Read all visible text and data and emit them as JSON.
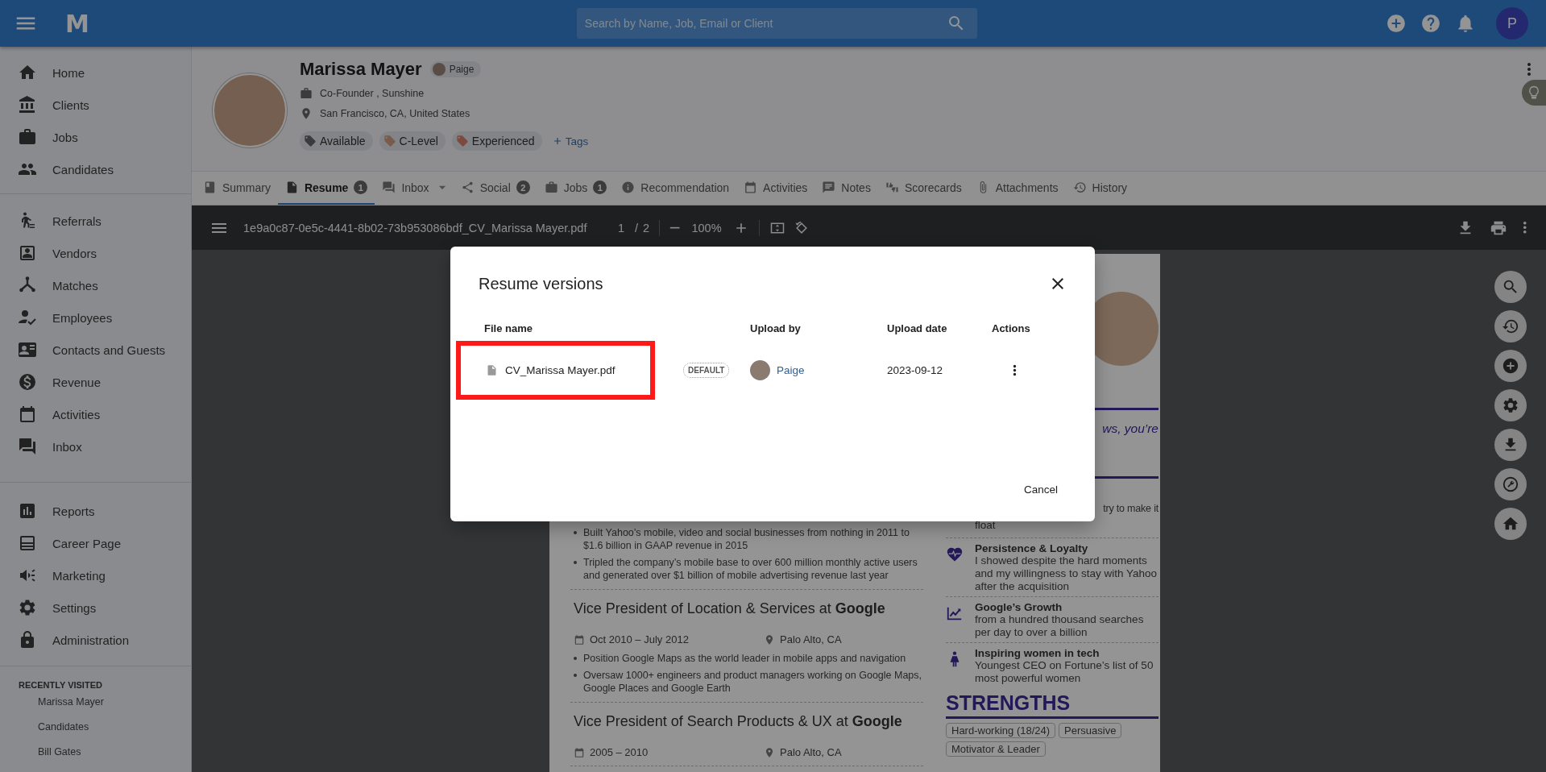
{
  "top_bar": {
    "logo": "M",
    "search": {
      "placeholder": "Search by Name, Job, Email or Client"
    },
    "avatar": "P"
  },
  "sidebar": {
    "groups": [
      {
        "items": [
          {
            "label": "Home",
            "kind": "home"
          },
          {
            "label": "Clients",
            "kind": "bank"
          },
          {
            "label": "Jobs",
            "kind": "briefcase"
          },
          {
            "label": "Candidates",
            "kind": "people"
          }
        ]
      },
      {
        "items": [
          {
            "label": "Referrals",
            "kind": "walker"
          },
          {
            "label": "Vendors",
            "kind": "contact"
          },
          {
            "label": "Matches",
            "kind": "network"
          },
          {
            "label": "Employees",
            "kind": "personcheck"
          },
          {
            "label": "Contacts and Guests",
            "kind": "card"
          },
          {
            "label": "Revenue",
            "kind": "dollar"
          },
          {
            "label": "Activities",
            "kind": "calendar"
          },
          {
            "label": "Inbox",
            "kind": "forum"
          }
        ]
      },
      {
        "items": [
          {
            "label": "Reports",
            "kind": "chart"
          },
          {
            "label": "Career Page",
            "kind": "layout"
          },
          {
            "label": "Marketing",
            "kind": "megaphone"
          },
          {
            "label": "Settings",
            "kind": "gear"
          },
          {
            "label": "Administration",
            "kind": "lock"
          }
        ]
      }
    ],
    "recent": {
      "title": "RECENTLY VISITED",
      "items": [
        "Marissa Mayer",
        "Candidates",
        "Bill Gates"
      ]
    }
  },
  "profile": {
    "name": "Marissa Mayer",
    "owner": "Paige",
    "position": "Co-Founder , Sunshine",
    "location": "San Francisco, CA, United States",
    "tags": [
      {
        "label": "Available",
        "color": "#3b3b3b"
      },
      {
        "label": "C-Level",
        "color": "#7a5a48"
      },
      {
        "label": "Experienced",
        "color": "#7d4a3e"
      }
    ],
    "add_tags": "Tags"
  },
  "tabs": [
    {
      "label": "Summary",
      "kind": "book",
      "dropdown": false,
      "selected": false
    },
    {
      "label": "Resume",
      "kind": "file",
      "badge": "1",
      "dropdown": false,
      "selected": true
    },
    {
      "label": "Inbox",
      "kind": "forum",
      "dropdown": true,
      "selected": false
    },
    {
      "label": "Social",
      "kind": "share",
      "badge": "2",
      "dropdown": false,
      "selected": false
    },
    {
      "label": "Jobs",
      "kind": "briefcase",
      "badge": "1",
      "dropdown": false,
      "selected": false
    },
    {
      "label": "Recommendation",
      "kind": "info",
      "dropdown": false,
      "selected": false
    },
    {
      "label": "Activities",
      "kind": "calendar",
      "dropdown": false,
      "selected": false
    },
    {
      "label": "Notes",
      "kind": "note",
      "dropdown": false,
      "selected": false
    },
    {
      "label": "Scorecards",
      "kind": "thumbs",
      "dropdown": false,
      "selected": false
    },
    {
      "label": "Attachments",
      "kind": "clip",
      "dropdown": false,
      "selected": false
    },
    {
      "label": "History",
      "kind": "history",
      "dropdown": false,
      "selected": false
    }
  ],
  "pdf_toolbar": {
    "file_name": "1e9a0c87-0e5c-4441-8b02-73b953086bdf_CV_Marissa Mayer.pdf",
    "page": "1",
    "separator": "/",
    "page_count": "2",
    "zoom": "100%"
  },
  "resume": {
    "leading_bullets": [
      "Built Yahoo’s mobile, video and social businesses from nothing in 2011 to $1.6 billion in GAAP revenue in 2015",
      "Tripled the company’s mobile base to over 600 million monthly active users and generated over $1 billion of mobile advertising revenue last year"
    ],
    "roles": [
      {
        "title": "Vice President of Location & Services at **Google**",
        "dates": "Oct 2010 – July 2012",
        "place": "Palo Alto, CA",
        "bullets": [
          "Position Google Maps as the world leader in mobile apps and navigation",
          "Oversaw 1000+ engineers and product managers working on Google Maps, Google Places and Google Earth"
        ]
      },
      {
        "title": "Vice President of Search Products & UX at **Google**",
        "dates": "2005 – 2010",
        "place": "Palo Alto, CA"
      }
    ],
    "quote_fragment": "ws, you’re",
    "fragment_line": "try to make it",
    "fragment_end": "float",
    "achievements": [
      {
        "kind": "heart",
        "title": "Persistence & Loyalty",
        "text": "I showed despite the hard moments and my willingness to stay with Yahoo after the acquisition"
      },
      {
        "kind": "growth",
        "title": "Google’s Growth",
        "text": "from a hundred thousand searches per day to over a billion"
      },
      {
        "kind": "woman",
        "title": "Inspiring women in tech",
        "text": "Youngest CEO on Fortune’s list of 50 most powerful women"
      }
    ],
    "strengths_title": "STRENGTHS",
    "strengths": [
      "Hard-working (18/24)",
      "Persuasive",
      "Motivator & Leader"
    ]
  },
  "dialog": {
    "title": "Resume versions",
    "columns": [
      "File name",
      "Upload by",
      "Upload date",
      "Actions"
    ],
    "rows": [
      {
        "file_name": "CV_Marissa Mayer.pdf",
        "badge": "DEFAULT",
        "uploaded_by": "Paige",
        "upload_date": "2023-09-12",
        "highlighted": true
      }
    ],
    "cancel": "Cancel"
  }
}
